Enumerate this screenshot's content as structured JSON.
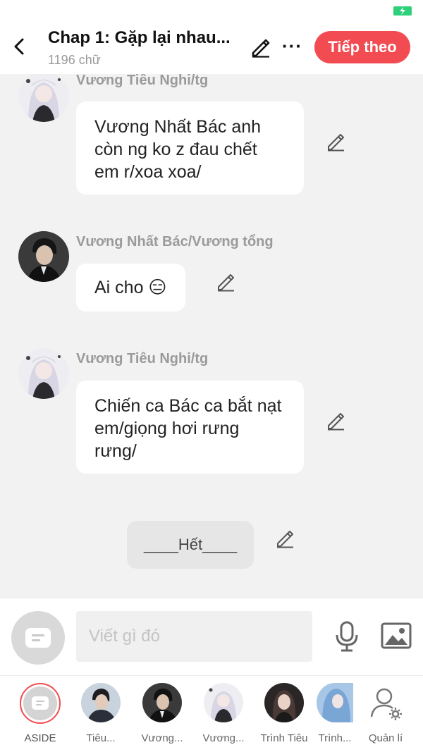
{
  "header": {
    "title": "Chap 1: Gặp lại nhau...",
    "word_count": "1196 chữ",
    "more_label": "···",
    "next_button": "Tiếp theo"
  },
  "messages": [
    {
      "sender": "Vương Tiêu Nghi/tg",
      "text": "Vương Nhất Bác anh còn ng ko z đau chết em r/xoa xoa/",
      "avatar": "girl-white-hair"
    },
    {
      "sender": "Vương Nhất Bác/Vương tổng",
      "text": "Ai cho 😑",
      "avatar": "man-dark-suit"
    },
    {
      "sender": "Vương Tiêu Nghi/tg",
      "text": "Chiến ca Bác ca bắt nạt em/giọng hơi rưng rưng/",
      "avatar": "girl-white-hair"
    }
  ],
  "end_text": "____Hết____",
  "compose": {
    "placeholder": "Viết gì đó"
  },
  "characters": [
    {
      "name": "ASIDE",
      "active": true
    },
    {
      "name": "Tiêu..."
    },
    {
      "name": "Vương..."
    },
    {
      "name": "Vương..."
    },
    {
      "name": "Trình Tiêu"
    },
    {
      "name": "Trình..."
    },
    {
      "name": "Quản lí"
    }
  ],
  "colors": {
    "accent": "#f24b52",
    "battery": "#2ed07a",
    "background": "#f2f2f2"
  }
}
